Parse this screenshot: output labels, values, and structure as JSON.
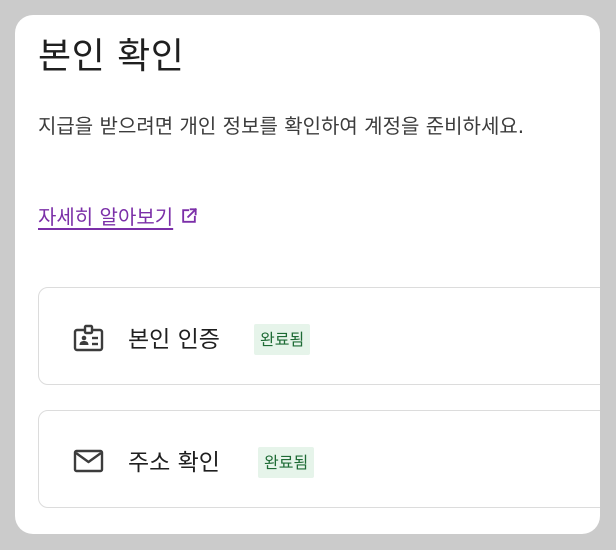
{
  "page": {
    "title": "본인 확인",
    "description": "지급을 받으려면 개인 정보를 확인하여 계정을 준비하세요.",
    "learn_more": "자세히 알아보기",
    "learn_more_icon": "open-in-new-icon",
    "accent_color": "#7b2fa8"
  },
  "items": [
    {
      "label": "본인 인증",
      "status": "완료됨",
      "icon": "id-badge-icon"
    },
    {
      "label": "주소 확인",
      "status": "완료됨",
      "icon": "mail-icon"
    }
  ],
  "colors": {
    "badge_bg": "#e6f4ea",
    "badge_text": "#1e6b35"
  }
}
